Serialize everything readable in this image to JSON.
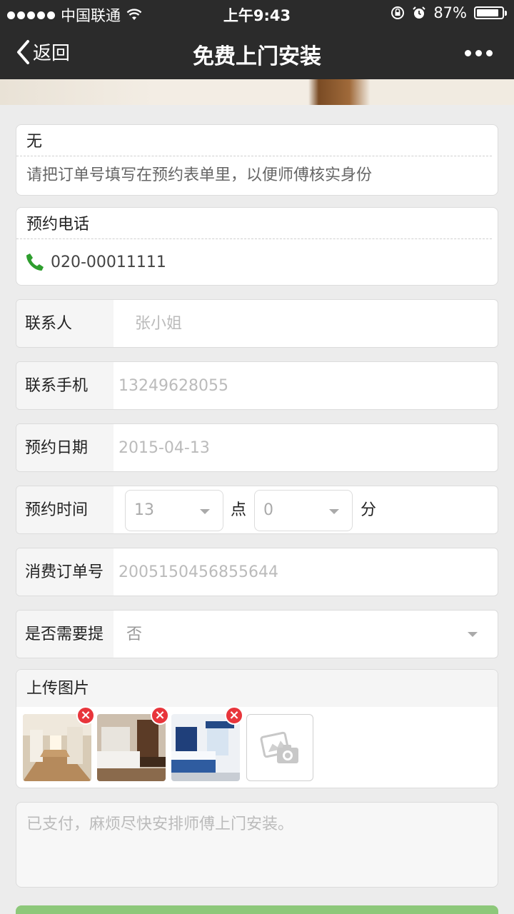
{
  "status_bar": {
    "carrier": "中国联通",
    "time": "上午9:43",
    "battery": "87%",
    "battery_level": 0.87
  },
  "nav": {
    "back_label": "返回",
    "title": "免费上门安装"
  },
  "notice_card": {
    "title": "无",
    "text": "请把订单号填写在预约表单里，以便师傅核实身份"
  },
  "phone_card": {
    "title": "预约电话",
    "phone": "020-00011111"
  },
  "form": {
    "contact": {
      "label": "联系人",
      "placeholder": "张小姐"
    },
    "mobile": {
      "label": "联系手机",
      "placeholder": "13249628055"
    },
    "date": {
      "label": "预约日期",
      "placeholder": "2015-04-13"
    },
    "time": {
      "label": "预约时间",
      "hour": "13",
      "hour_unit": "点",
      "minute": "0",
      "minute_unit": "分"
    },
    "order": {
      "label": "消费订单号",
      "placeholder": "2005150456855644"
    },
    "reminder": {
      "label": "是否需要提",
      "value": "否"
    }
  },
  "upload": {
    "title": "上传图片",
    "photos": [
      "photo-hallway",
      "photo-bedroom-wood",
      "photo-bedroom-blue"
    ]
  },
  "remark": {
    "placeholder": "已支付，麻烦尽快安排师傅上门安装。"
  },
  "colors": {
    "nav_bg": "#2b2b2b",
    "page_bg": "#ececec",
    "phone_icon": "#2e9e2e",
    "delete_badge": "#e8353b",
    "submit": "#8dc87a"
  }
}
